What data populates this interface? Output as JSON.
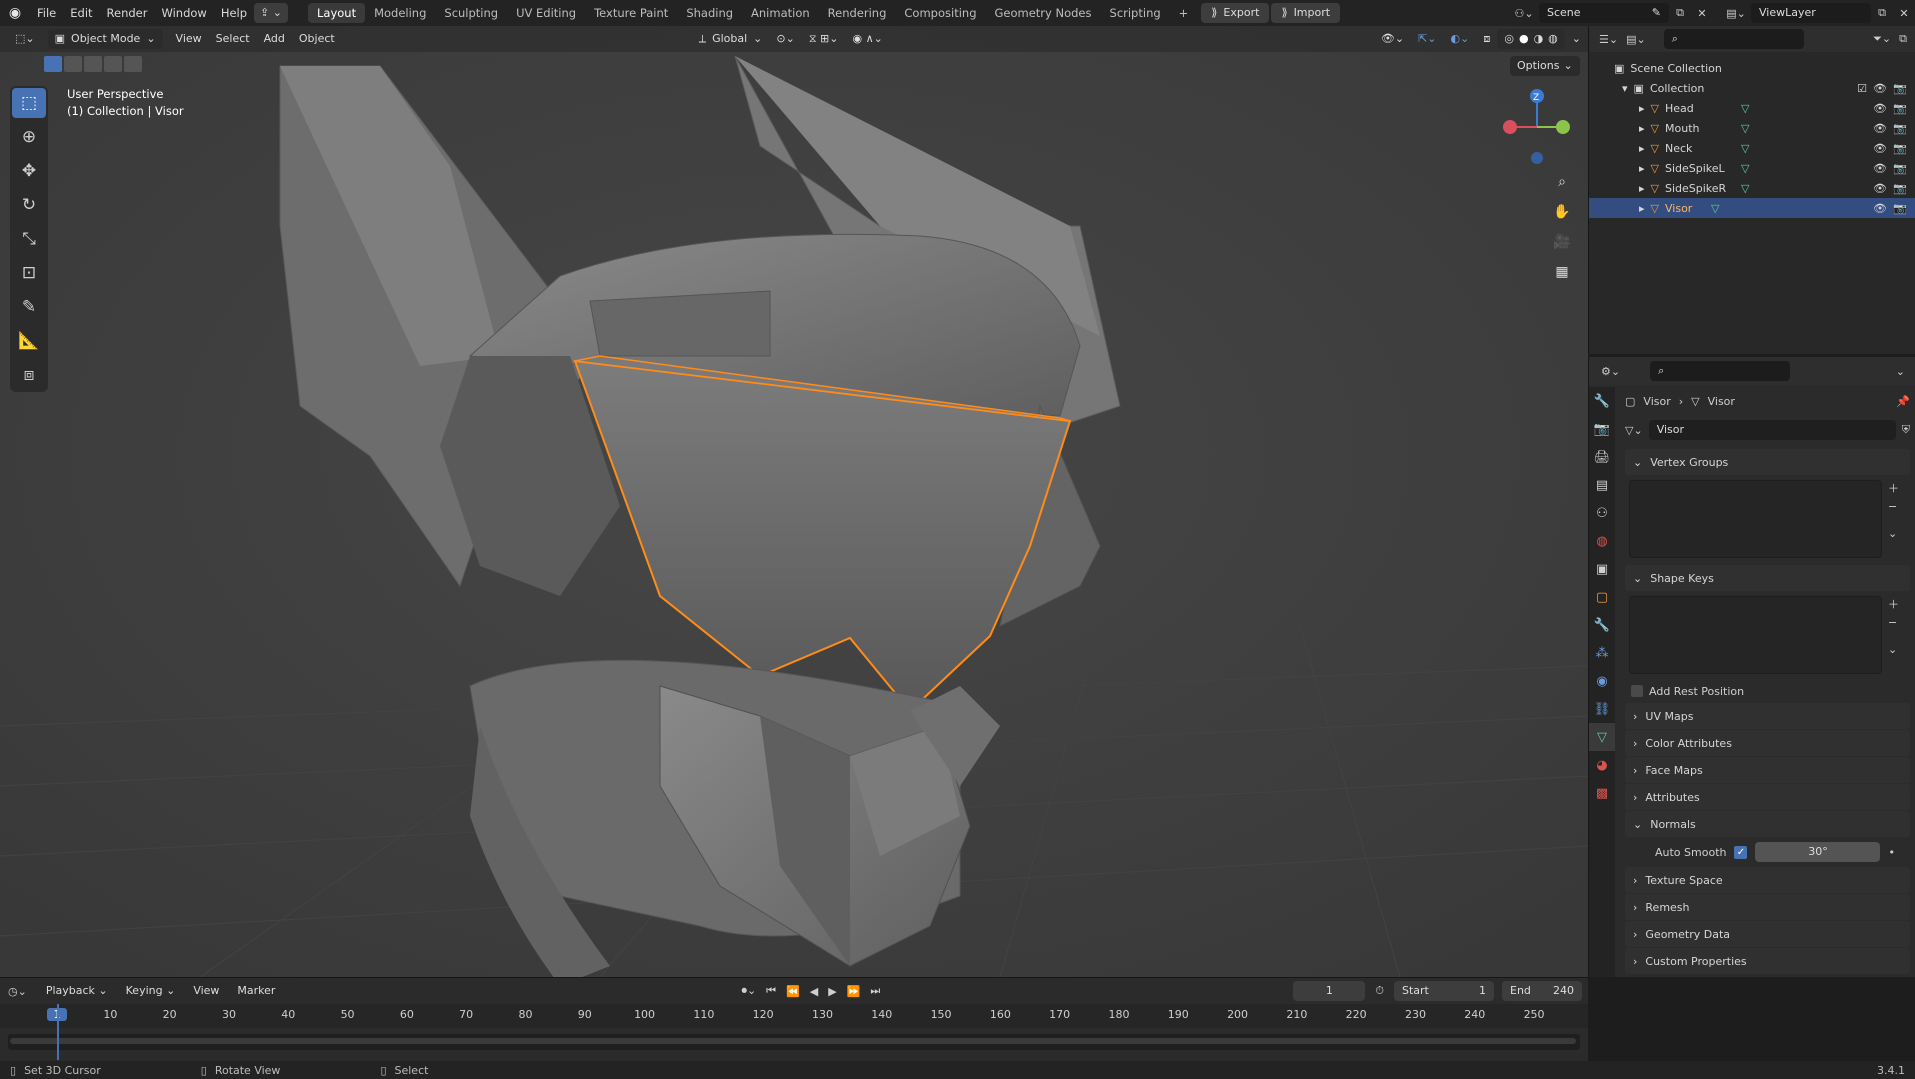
{
  "topbar": {
    "menus": [
      "File",
      "Edit",
      "Render",
      "Window",
      "Help"
    ],
    "workspaces": [
      "Layout",
      "Modeling",
      "Sculpting",
      "UV Editing",
      "Texture Paint",
      "Shading",
      "Animation",
      "Rendering",
      "Compositing",
      "Geometry Nodes",
      "Scripting"
    ],
    "add_tab": "+",
    "export_label": "Export",
    "import_label": "Import",
    "scene_name": "Scene",
    "view_layer": "ViewLayer"
  },
  "viewport": {
    "mode": "Object Mode",
    "menus": [
      "View",
      "Select",
      "Add",
      "Object"
    ],
    "orientation": "Global",
    "options_label": "Options",
    "info_line1": "User Perspective",
    "info_line2": "(1) Collection | Visor",
    "gizmo_axes": {
      "x": "X",
      "y": "Y",
      "z": "Z"
    },
    "selection_outline_color": "#ff8c1a",
    "tools": [
      "select-box",
      "cursor",
      "move",
      "rotate",
      "scale",
      "transform",
      "annotate",
      "measure",
      "add-cube"
    ]
  },
  "outliner": {
    "root": "Scene Collection",
    "collection": "Collection",
    "items": [
      {
        "name": "Head",
        "selected": false
      },
      {
        "name": "Mouth",
        "selected": false
      },
      {
        "name": "Neck",
        "selected": false
      },
      {
        "name": "SideSpikeL",
        "selected": false
      },
      {
        "name": "SideSpikeR",
        "selected": false
      },
      {
        "name": "Visor",
        "selected": true
      }
    ]
  },
  "properties": {
    "breadcrumb_object": "Visor",
    "breadcrumb_data": "Visor",
    "mesh_name": "Visor",
    "panels": {
      "vertex_groups": "Vertex Groups",
      "shape_keys": "Shape Keys",
      "add_rest_position": "Add Rest Position",
      "uv_maps": "UV Maps",
      "color_attributes": "Color Attributes",
      "face_maps": "Face Maps",
      "attributes": "Attributes",
      "normals": "Normals",
      "auto_smooth_label": "Auto Smooth",
      "auto_smooth_angle": "30°",
      "texture_space": "Texture Space",
      "remesh": "Remesh",
      "geometry_data": "Geometry Data",
      "custom_properties": "Custom Properties"
    }
  },
  "timeline": {
    "menus": [
      "Playback",
      "Keying",
      "View",
      "Marker"
    ],
    "current_frame": "1",
    "start_label": "Start",
    "start_value": "1",
    "end_label": "End",
    "end_value": "240",
    "ticks": [
      "1",
      "10",
      "20",
      "30",
      "40",
      "50",
      "60",
      "70",
      "80",
      "90",
      "100",
      "110",
      "120",
      "130",
      "140",
      "150",
      "160",
      "170",
      "180",
      "190",
      "200",
      "210",
      "220",
      "230",
      "240",
      "250"
    ]
  },
  "statusbar": {
    "hint1": "Set 3D Cursor",
    "hint2": "Rotate View",
    "hint3": "Select",
    "version": "3.4.1"
  }
}
